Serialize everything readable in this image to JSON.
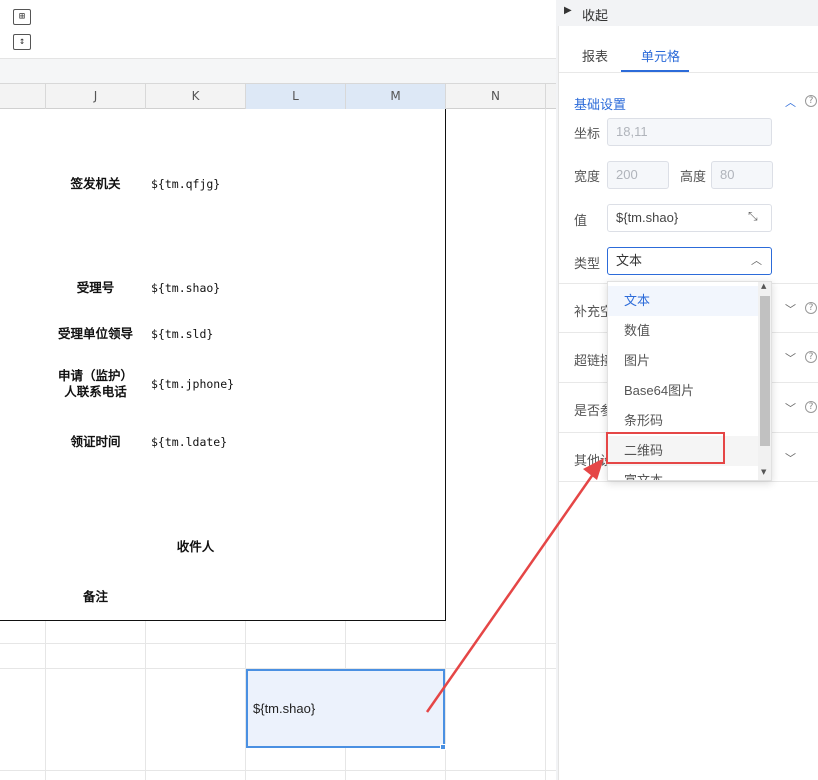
{
  "toolbar": {
    "icon1": "merge-cells-icon",
    "icon2": "insert-row-icon"
  },
  "columns": [
    "J",
    "K",
    "L",
    "M",
    "N"
  ],
  "report": {
    "rows": [
      {
        "label": "签发机关",
        "value": "${tm.qfjg}"
      },
      {
        "label": "受理号",
        "value": "${tm.shao}"
      },
      {
        "label": "受理单位领导",
        "value": "${tm.sld}"
      },
      {
        "label": "申请（监护）\n人联系电话",
        "value": "${tm.jphone}"
      },
      {
        "label": "领证时间",
        "value": "${tm.ldate}"
      }
    ],
    "recipient_label": "收件人",
    "remark_label": "备注"
  },
  "selected_cell": {
    "value": "${tm.shao}"
  },
  "panel": {
    "collapse_label": "收起",
    "tabs": [
      {
        "label": "报表",
        "active": false
      },
      {
        "label": "单元格",
        "active": true
      }
    ],
    "basic_section_title": "基础设置",
    "coord_label": "坐标",
    "coord_value": "18,11",
    "width_label": "宽度",
    "width_value": "200",
    "height_label": "高度",
    "height_value": "80",
    "value_label": "值",
    "value_value": "${tm.shao}",
    "type_label": "类型",
    "type_value": "文本",
    "sections": [
      {
        "label": "补充空"
      },
      {
        "label": "超链接"
      },
      {
        "label": "是否参"
      },
      {
        "label": "其他设"
      }
    ]
  },
  "dropdown": {
    "options": [
      "文本",
      "数值",
      "图片",
      "Base64图片",
      "条形码",
      "二维码",
      "富文本"
    ],
    "selected": "文本",
    "highlighted": "二维码"
  },
  "colors": {
    "accent": "#2c6bd9",
    "annotation_red": "#e54646",
    "selection_blue": "#4a90e2"
  }
}
